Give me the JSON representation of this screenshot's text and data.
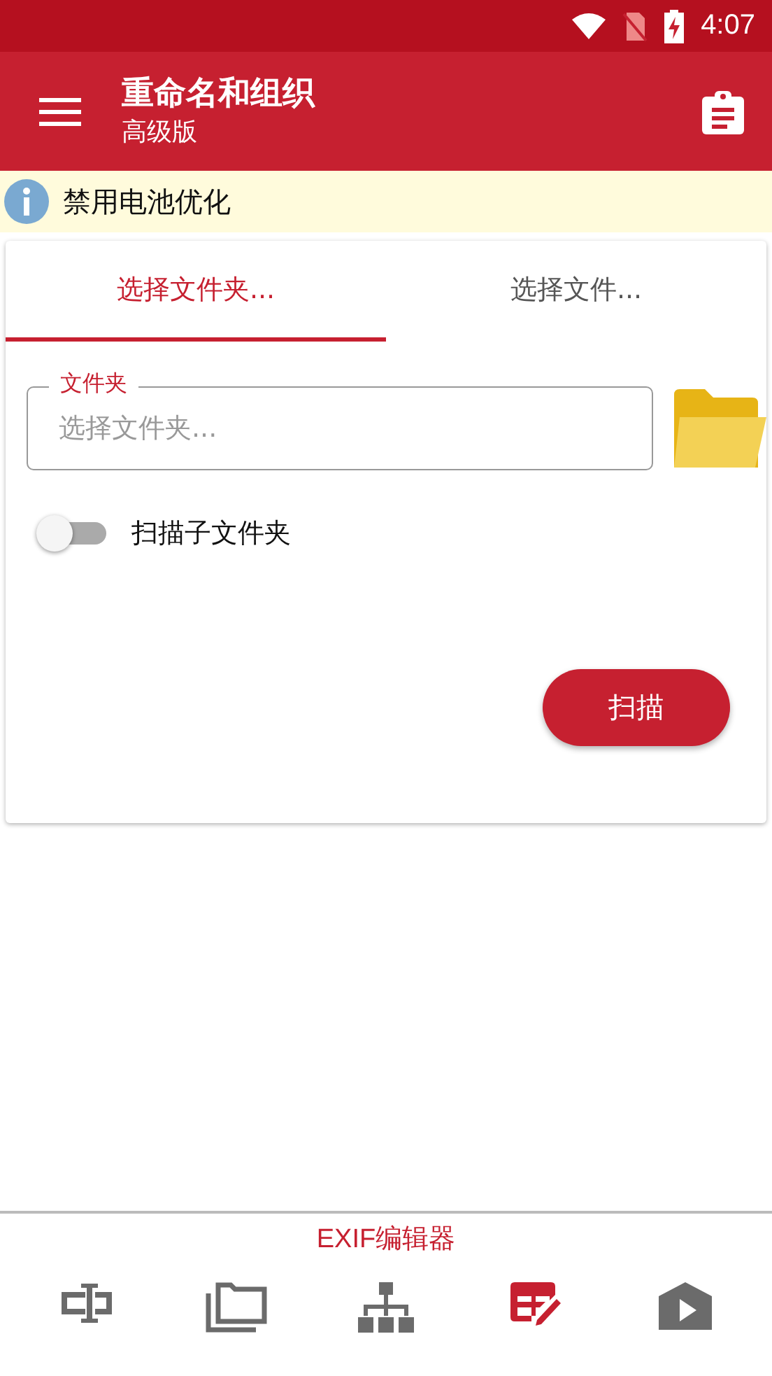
{
  "status_bar": {
    "time": "4:07"
  },
  "app_bar": {
    "title": "重命名和组织",
    "subtitle": "高级版"
  },
  "banner": {
    "text": "禁用电池优化"
  },
  "tabs": [
    {
      "label": "选择文件夹...",
      "selected": true
    },
    {
      "label": "选择文件...",
      "selected": false
    }
  ],
  "folder_field": {
    "label": "文件夹",
    "placeholder": "选择文件夹..."
  },
  "scan_subfolders": {
    "label": "扫描子文件夹",
    "on": false
  },
  "scan_button": "扫描",
  "bottom_nav": [
    {
      "kind": "rename",
      "selected": false
    },
    {
      "kind": "folders",
      "selected": false
    },
    {
      "kind": "tree",
      "selected": false
    },
    {
      "kind": "exif",
      "selected": true,
      "label": "EXIF编辑器"
    },
    {
      "kind": "video",
      "selected": false
    }
  ]
}
